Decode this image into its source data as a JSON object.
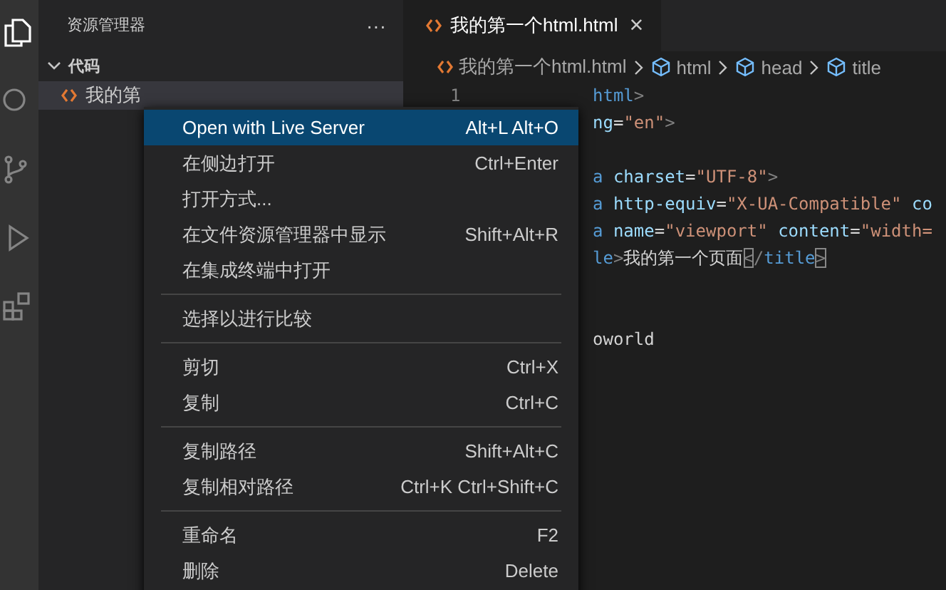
{
  "activity_bar": {
    "items": [
      {
        "kind": "files",
        "selected": true
      },
      {
        "kind": "search",
        "selected": false
      },
      {
        "kind": "source-control",
        "selected": false
      },
      {
        "kind": "run",
        "selected": false
      },
      {
        "kind": "extensions",
        "selected": false
      }
    ]
  },
  "sidebar": {
    "title": "资源管理器",
    "more": "···",
    "folder": {
      "name": "代码",
      "expanded": true,
      "files": [
        {
          "name": "我的第",
          "selected": true
        }
      ]
    }
  },
  "editor": {
    "tabs": [
      {
        "label": "我的第一个html.html",
        "selected": true,
        "close": "×"
      }
    ],
    "breadcrumb": [
      {
        "kind": "file",
        "label": "我的第一个html.html"
      },
      {
        "kind": "symbol",
        "label": "html"
      },
      {
        "kind": "symbol",
        "label": "head"
      },
      {
        "kind": "symbol",
        "label": "title"
      }
    ],
    "line_number": "1",
    "lines": [
      {
        "kind": "code",
        "tokens": [
          {
            "kind": "tag",
            "text": "html"
          },
          {
            "kind": "punct",
            "text": ">"
          }
        ]
      },
      {
        "kind": "code",
        "tokens": [
          {
            "kind": "attr",
            "text": "ng"
          },
          {
            "kind": "text",
            "text": "="
          },
          {
            "kind": "string",
            "text": "\"en\""
          },
          {
            "kind": "punct",
            "text": ">"
          }
        ]
      },
      {
        "kind": "blank"
      },
      {
        "kind": "code",
        "tokens": [
          {
            "kind": "tag",
            "text": "a"
          },
          {
            "kind": "attr",
            "text": "charset",
            "space_before": true
          },
          {
            "kind": "text",
            "text": "="
          },
          {
            "kind": "string",
            "text": "\"UTF-8\""
          },
          {
            "kind": "punct",
            "text": ">"
          }
        ]
      },
      {
        "kind": "code",
        "tokens": [
          {
            "kind": "tag",
            "text": "a"
          },
          {
            "kind": "attr",
            "text": "http-equiv",
            "space_before": true
          },
          {
            "kind": "text",
            "text": "="
          },
          {
            "kind": "string",
            "text": "\"X-UA-Compatible\""
          },
          {
            "kind": "attr",
            "text": "co",
            "space_before": true
          }
        ]
      },
      {
        "kind": "code",
        "tokens": [
          {
            "kind": "tag",
            "text": "a"
          },
          {
            "kind": "attr",
            "text": "name",
            "space_before": true
          },
          {
            "kind": "text",
            "text": "="
          },
          {
            "kind": "string",
            "text": "\"viewport\""
          },
          {
            "kind": "attr",
            "text": "content",
            "space_before": true
          },
          {
            "kind": "text",
            "text": "="
          },
          {
            "kind": "string",
            "text": "\"width="
          }
        ]
      },
      {
        "kind": "code",
        "tokens": [
          {
            "kind": "tag",
            "text": "le"
          },
          {
            "kind": "punct",
            "text": ">"
          },
          {
            "kind": "text",
            "text": "我的第一个页面"
          },
          {
            "kind": "bracket",
            "text": "<"
          },
          {
            "kind": "punct",
            "text": "/"
          },
          {
            "kind": "tag",
            "text": "title"
          },
          {
            "kind": "bracket",
            "text": ">"
          }
        ]
      },
      {
        "kind": "blank"
      },
      {
        "kind": "blank"
      },
      {
        "kind": "code",
        "tokens": [
          {
            "kind": "text",
            "text": "oworld"
          }
        ]
      }
    ]
  },
  "context_menu": {
    "items": [
      {
        "kind": "item",
        "label": "Open with Live Server",
        "shortcut": "Alt+L Alt+O",
        "selected": true
      },
      {
        "kind": "item",
        "label": "在侧边打开",
        "shortcut": "Ctrl+Enter",
        "selected": false
      },
      {
        "kind": "item",
        "label": "打开方式...",
        "selected": false
      },
      {
        "kind": "item",
        "label": "在文件资源管理器中显示",
        "shortcut": "Shift+Alt+R",
        "selected": false
      },
      {
        "kind": "item",
        "label": "在集成终端中打开",
        "selected": false
      },
      {
        "kind": "separator"
      },
      {
        "kind": "item",
        "label": "选择以进行比较",
        "selected": false
      },
      {
        "kind": "separator"
      },
      {
        "kind": "item",
        "label": "剪切",
        "shortcut": "Ctrl+X",
        "selected": false
      },
      {
        "kind": "item",
        "label": "复制",
        "shortcut": "Ctrl+C",
        "selected": false
      },
      {
        "kind": "separator"
      },
      {
        "kind": "item",
        "label": "复制路径",
        "shortcut": "Shift+Alt+C",
        "selected": false
      },
      {
        "kind": "item",
        "label": "复制相对路径",
        "shortcut": "Ctrl+K Ctrl+Shift+C",
        "selected": false
      },
      {
        "kind": "separator"
      },
      {
        "kind": "item",
        "label": "重命名",
        "shortcut": "F2",
        "selected": false
      },
      {
        "kind": "item",
        "label": "删除",
        "shortcut": "Delete",
        "selected": false
      }
    ]
  }
}
